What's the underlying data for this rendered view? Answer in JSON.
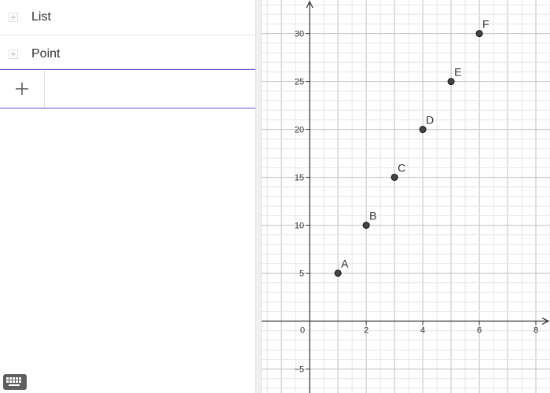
{
  "algebra": {
    "groups": [
      {
        "label": "List"
      },
      {
        "label": "Point"
      }
    ],
    "input_value": ""
  },
  "graph": {
    "x_axis": {
      "min": -1.7,
      "max": 8.5,
      "ticks": [
        2,
        4,
        6,
        8
      ],
      "origin_label": "0"
    },
    "y_axis": {
      "min": -7.5,
      "max": 33.5,
      "ticks": [
        -5,
        5,
        10,
        15,
        20,
        25,
        30
      ]
    },
    "grid": true,
    "points": [
      {
        "label": "A",
        "x": 1,
        "y": 5
      },
      {
        "label": "B",
        "x": 2,
        "y": 10
      },
      {
        "label": "C",
        "x": 3,
        "y": 15
      },
      {
        "label": "D",
        "x": 4,
        "y": 20
      },
      {
        "label": "E",
        "x": 5,
        "y": 25
      },
      {
        "label": "F",
        "x": 6,
        "y": 30
      }
    ]
  },
  "colors": {
    "accent": "#6557d2",
    "point_fill": "#444444",
    "grid_minor": "#e6e6e6",
    "grid_major": "#c0c0c0",
    "axis": "#333333"
  },
  "icons": {
    "add": "plus-icon",
    "expand": "plus-icon",
    "keyboard": "keyboard-icon"
  }
}
